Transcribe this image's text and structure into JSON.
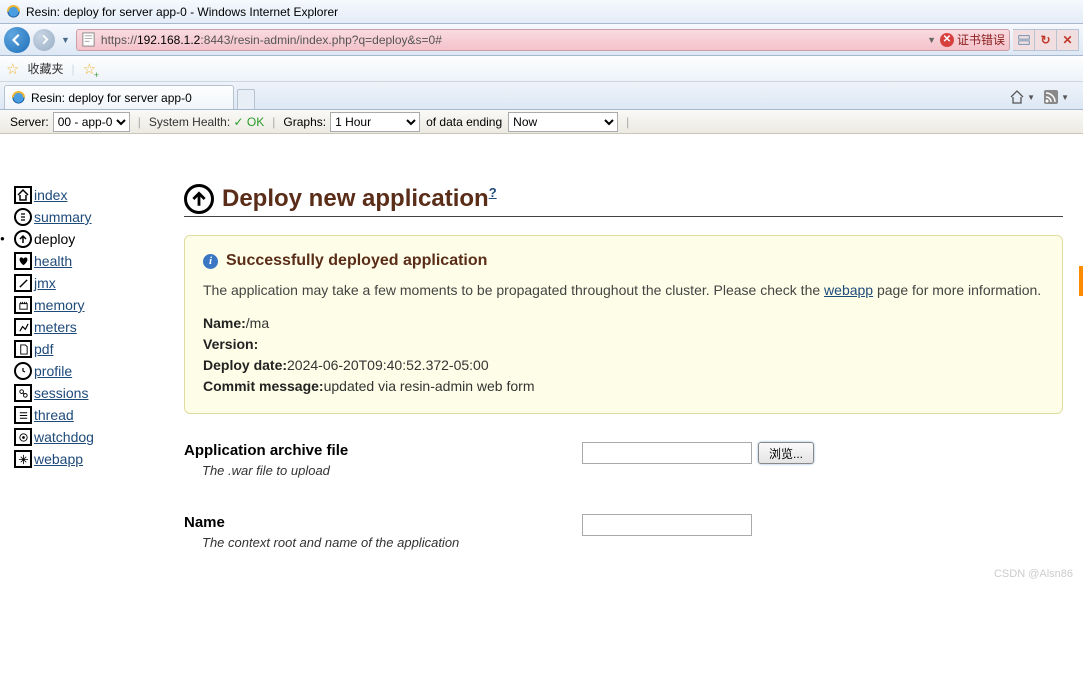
{
  "window": {
    "title": "Resin: deploy for server app-0 - Windows Internet Explorer"
  },
  "address": {
    "scheme": "https://",
    "host": "192.168.1.2",
    "path": ":8443/resin-admin/index.php?q=deploy&s=0#",
    "cert_error": "证书错误"
  },
  "favorites": {
    "label": "收藏夹"
  },
  "tab": {
    "title": "Resin: deploy for server app-0"
  },
  "statusbar": {
    "server_label": "Server:",
    "server_value": "00 - app-0",
    "health_label": "System Health:",
    "health_status": "OK",
    "graphs_label": "Graphs:",
    "graphs_value": "1 Hour",
    "ending_label": "of data ending",
    "ending_value": "Now"
  },
  "sidebar": {
    "items": [
      {
        "label": "index"
      },
      {
        "label": "summary"
      },
      {
        "label": "deploy",
        "active": true
      },
      {
        "label": "health"
      },
      {
        "label": "jmx"
      },
      {
        "label": "memory"
      },
      {
        "label": "meters"
      },
      {
        "label": "pdf"
      },
      {
        "label": "profile"
      },
      {
        "label": "sessions"
      },
      {
        "label": "thread"
      },
      {
        "label": "watchdog"
      },
      {
        "label": "webapp"
      }
    ]
  },
  "deploy": {
    "heading": "Deploy new application",
    "help": "?",
    "alert_title": "Successfully deployed application",
    "alert_body_1": "The application may take a few moments to be propagated throughout the cluster. Please check the ",
    "alert_body_link": "webapp",
    "alert_body_2": " page for more information.",
    "name_label": "Name:",
    "name_value": "/ma",
    "version_label": "Version:",
    "version_value": "",
    "date_label": "Deploy date:",
    "date_value": "2024-06-20T09:40:52.372-05:00",
    "commit_label": "Commit message:",
    "commit_value": "updated via resin-admin web form"
  },
  "form": {
    "archive_label": "Application archive file",
    "archive_desc": "The .war file to upload",
    "browse_btn": "浏览...",
    "name_label": "Name",
    "name_desc": "The context root and name of the application"
  },
  "watermark": "CSDN @Alsn86"
}
